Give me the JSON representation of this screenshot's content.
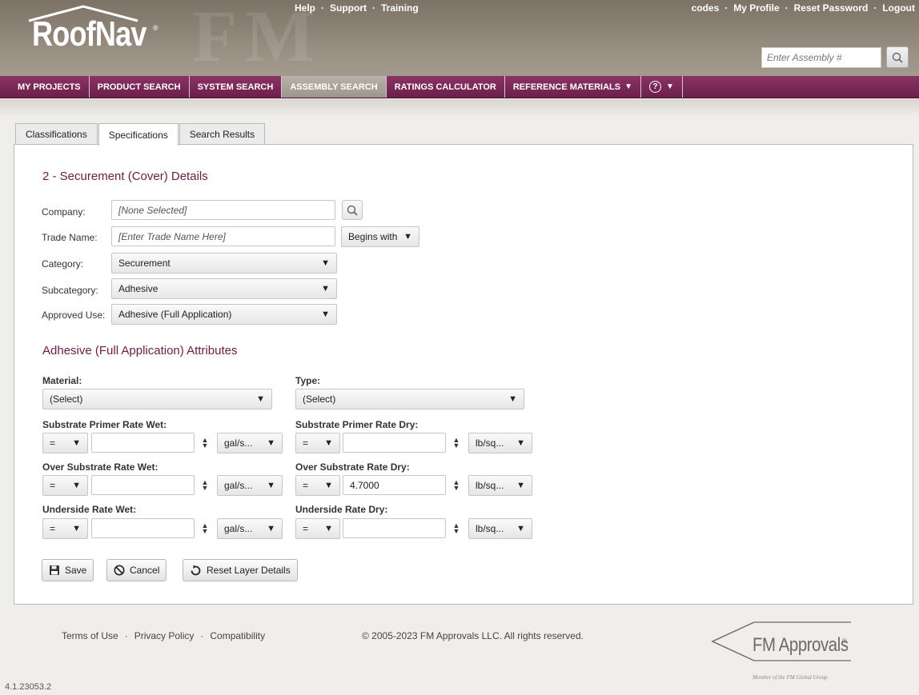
{
  "header": {
    "logo": "RoofNav",
    "logo_reg": "®",
    "links_center": [
      "Help",
      "Support",
      "Training"
    ],
    "links_right": [
      "codes",
      "My Profile",
      "Reset Password",
      "Logout"
    ],
    "link_separator": "·",
    "assembly_placeholder": "Enter Assembly #"
  },
  "nav": {
    "items": [
      "MY PROJECTS",
      "PRODUCT SEARCH",
      "SYSTEM SEARCH",
      "ASSEMBLY SEARCH",
      "RATINGS CALCULATOR",
      "REFERENCE MATERIALS"
    ],
    "active": "ASSEMBLY SEARCH",
    "help_symbol": "?",
    "caret": "▼"
  },
  "tabs": [
    "Classifications",
    "Specifications",
    "Search Results"
  ],
  "form": {
    "section_title": "2 - Securement (Cover) Details",
    "company": {
      "label": "Company:",
      "placeholder": "[None Selected]"
    },
    "trade_name": {
      "label": "Trade Name:",
      "placeholder": "[Enter Trade Name Here]",
      "match_mode": "Begins with"
    },
    "category": {
      "label": "Category:",
      "value": "Securement"
    },
    "subcategory": {
      "label": "Subcategory:",
      "value": "Adhesive"
    },
    "approved_use": {
      "label": "Approved Use:",
      "value": "Adhesive (Full Application)"
    }
  },
  "attributes": {
    "title": "Adhesive (Full Application) Attributes",
    "material": {
      "label": "Material:",
      "value": "(Select)"
    },
    "type": {
      "label": "Type:",
      "value": "(Select)"
    },
    "rows": [
      {
        "left": {
          "label": "Substrate Primer Rate Wet:",
          "op": "=",
          "value": "",
          "unit": "gal/s..."
        },
        "right": {
          "label": "Substrate Primer Rate Dry:",
          "op": "=",
          "value": "",
          "unit": "lb/sq..."
        }
      },
      {
        "left": {
          "label": "Over Substrate Rate Wet:",
          "op": "=",
          "value": "",
          "unit": "gal/s..."
        },
        "right": {
          "label": "Over Substrate Rate Dry:",
          "op": "=",
          "value": "4.7000",
          "unit": "lb/sq..."
        }
      },
      {
        "left": {
          "label": "Underside Rate Wet:",
          "op": "=",
          "value": "",
          "unit": "gal/s..."
        },
        "right": {
          "label": "Underside Rate Dry:",
          "op": "=",
          "value": "",
          "unit": "lb/sq..."
        }
      }
    ]
  },
  "buttons": {
    "save": "Save",
    "cancel": "Cancel",
    "reset": "Reset Layer Details"
  },
  "footer": {
    "links": [
      "Terms of Use",
      "Privacy Policy",
      "Compatibility"
    ],
    "copyright": "© 2005-2023 FM Approvals LLC. All rights reserved.",
    "version": "4.1.23053.2",
    "fm_logo": "FM Approvals",
    "fm_reg": "®",
    "fm_tagline": "Member of the FM Global Group"
  },
  "colors": {
    "brand": "#7a2a58",
    "section_title": "#6b1c45"
  }
}
